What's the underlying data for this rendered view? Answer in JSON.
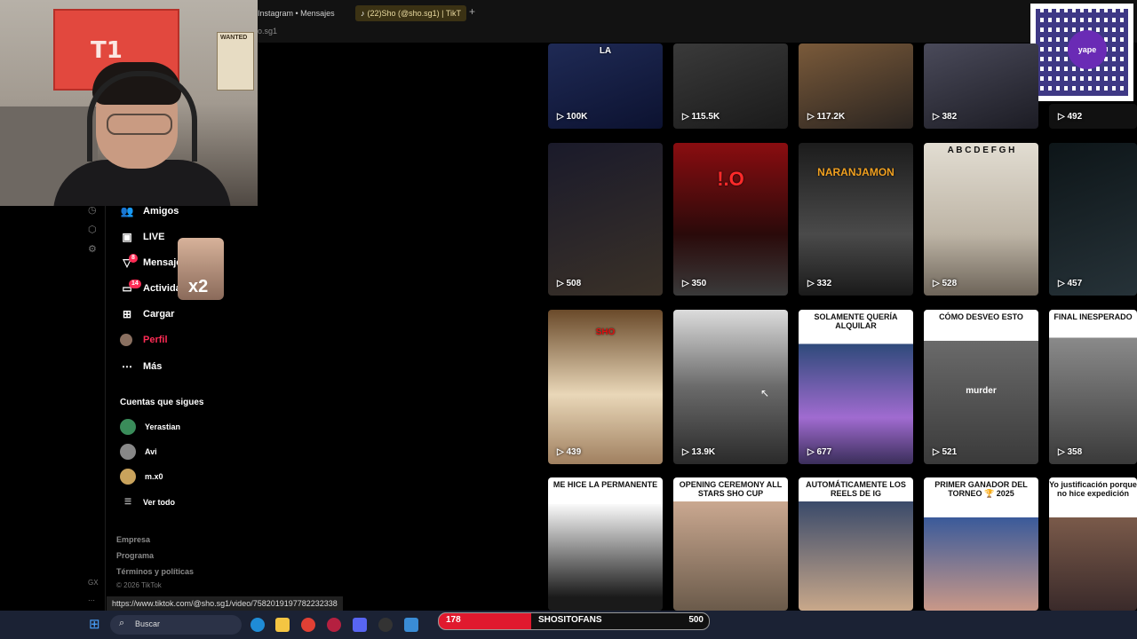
{
  "browser": {
    "tabs": [
      {
        "label": "Instagram • Mensajes",
        "active": false
      },
      {
        "label": "(22)Sho (@sho.sg1) | TikT",
        "active": true
      }
    ],
    "url_fragment": "o.sg1",
    "status_url": "https://www.tiktok.com/@sho.sg1/video/7582019197782232338"
  },
  "webcam": {
    "flag_logo": "T1",
    "poster_text": "WANTED"
  },
  "qr": {
    "logo_text": "yape"
  },
  "sidebar": {
    "nav": [
      {
        "label": "Amigos",
        "icon": "friends-icon",
        "glyph": "👥"
      },
      {
        "label": "LIVE",
        "icon": "live-icon",
        "glyph": "▣"
      },
      {
        "label": "Mensajes",
        "icon": "messages-icon",
        "glyph": "▽",
        "badge": "8"
      },
      {
        "label": "Actividad",
        "icon": "activity-icon",
        "glyph": "▭",
        "badge": "14"
      },
      {
        "label": "Cargar",
        "icon": "upload-icon",
        "glyph": "⊞"
      },
      {
        "label": "Perfil",
        "icon": "profile-avatar",
        "glyph": "●",
        "active": true
      },
      {
        "label": "Más",
        "icon": "more-icon",
        "glyph": "⋯"
      }
    ],
    "overlay_text": "x2",
    "following_title": "Cuentas que sigues",
    "following": [
      {
        "name": "Yerastian",
        "color": "#3a8c5a"
      },
      {
        "name": "Avi",
        "color": "#888888"
      },
      {
        "name": "m.x0",
        "color": "#c9a35c"
      }
    ],
    "see_all": "Ver todo",
    "footer_links": [
      "Empresa",
      "Programa",
      "Términos y políticas"
    ],
    "copyright": "© 2026 TikTok",
    "ext_labels": [
      "GX",
      "⋯"
    ]
  },
  "videos": [
    {
      "views": "100K",
      "caption": "LA"
    },
    {
      "views": "115.5K"
    },
    {
      "views": "117.2K"
    },
    {
      "views": "382"
    },
    {
      "views": "492"
    },
    {
      "views": "508"
    },
    {
      "views": "350",
      "caption": "!.O"
    },
    {
      "views": "332",
      "caption": "NARANJAMON"
    },
    {
      "views": "528",
      "caption": "A B C D E F G H"
    },
    {
      "views": "457"
    },
    {
      "views": "439",
      "caption": "SHO"
    },
    {
      "views": "13.9K"
    },
    {
      "views": "677",
      "caption": "SOLAMENTE QUERÍA ALQUILAR"
    },
    {
      "views": "521",
      "caption": "CÓMO DESVEO ESTO",
      "mid": "murder"
    },
    {
      "views": "358",
      "caption": "FINAL INESPERADO"
    },
    {
      "caption": "ME HICE LA PERMANENTE"
    },
    {
      "caption": "OPENING CEREMONY ALL STARS SHO CUP"
    },
    {
      "caption": "AUTOMÁTICAMENTE LOS REELS DE IG"
    },
    {
      "caption": "PRIMER GANADOR DEL TORNEO 🏆 2025"
    },
    {
      "caption": "Yo justificación porque no hice expedición"
    }
  ],
  "taskbar": {
    "search_placeholder": "Buscar",
    "bar": {
      "left_value": "178",
      "label": "SHOSITOFANS",
      "right_value": "500"
    }
  }
}
